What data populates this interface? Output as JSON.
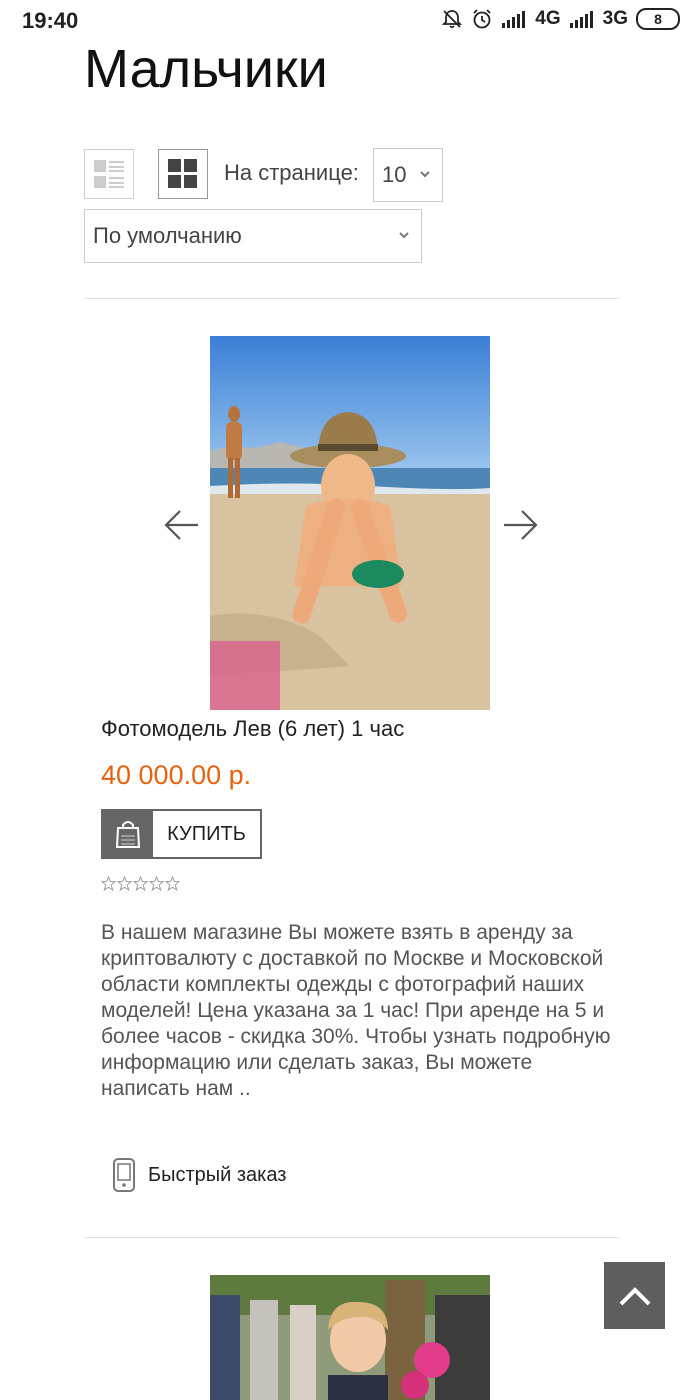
{
  "status_bar": {
    "time": "19:40",
    "network_1": "4G",
    "network_2": "3G",
    "battery": "8",
    "icons": [
      "bell-off-icon",
      "alarm-icon",
      "signal-icon",
      "battery-icon"
    ]
  },
  "page": {
    "title": "Мальчики"
  },
  "toolbar": {
    "per_page_label": "На странице:",
    "per_page_value": "10",
    "sort_value": "По умолчанию",
    "icons": [
      "list-view-icon",
      "grid-view-icon",
      "chevron-down-icon"
    ]
  },
  "product": {
    "name": "Фотомодель Лев (6 лет) 1 час",
    "price": "40 000.00 р.",
    "price_color": "#e8620f",
    "buy_label": "КУПИТЬ",
    "rating_stars": 0,
    "rating_max": 5,
    "description": "В нашем магазине Вы можете взять в аренду за криптовалюту с доставкой по Москве и Московской области комплекты одежды с фотографий наших моделей! Цена указана за 1 час! При аренде на 5 и более часов - скидка 30%. Чтобы узнать подробную информацию или сделать заказ, Вы можете написать нам ..",
    "quick_order_label": "Быстрый заказ",
    "icons": [
      "arrow-left-icon",
      "arrow-right-icon",
      "shopping-bag-icon",
      "phone-icon",
      "star-icon"
    ]
  },
  "scroll_top": {
    "icon": "chevron-up-icon"
  }
}
